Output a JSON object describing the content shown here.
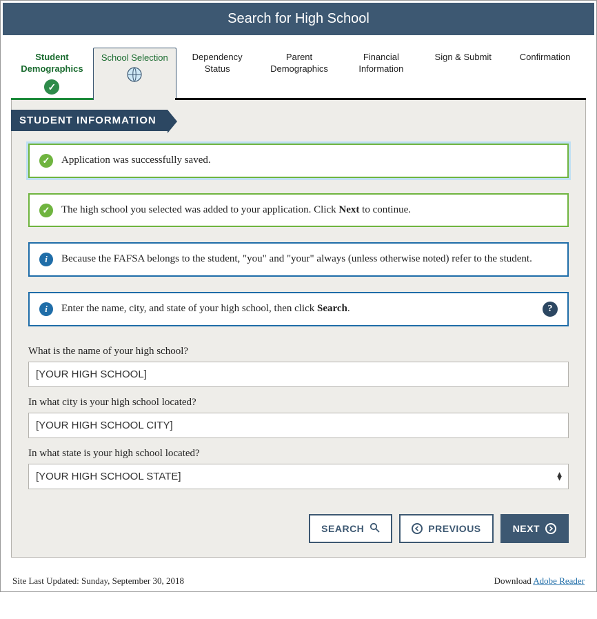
{
  "header": {
    "title": "Search for High School"
  },
  "tabs": [
    {
      "label": "Student Demographics",
      "state": "completed"
    },
    {
      "label": "School Selection",
      "state": "active"
    },
    {
      "label": "Dependency Status",
      "state": "default"
    },
    {
      "label": "Parent Demographics",
      "state": "default"
    },
    {
      "label": "Financial Information",
      "state": "default"
    },
    {
      "label": "Sign & Submit",
      "state": "default"
    },
    {
      "label": "Confirmation",
      "state": "default"
    }
  ],
  "section_ribbon": "STUDENT INFORMATION",
  "alerts": {
    "saved": "Application was successfully saved.",
    "added_prefix": "The high school you selected was added to your application. Click ",
    "added_bold": "Next",
    "added_suffix": " to continue.",
    "ownership": "Because the FAFSA belongs to the student, \"you\" and \"your\" always (unless otherwise noted) refer to the student.",
    "instruction_prefix": "Enter the name, city, and state of your high school, then click ",
    "instruction_bold": "Search",
    "instruction_suffix": "."
  },
  "fields": {
    "name": {
      "label": "What is the name of your high school?",
      "value": "[YOUR HIGH SCHOOL]"
    },
    "city": {
      "label": "In what city is your high school located?",
      "value": "[YOUR HIGH SCHOOL CITY]"
    },
    "state": {
      "label": "In what state is your high school located?",
      "value": "[YOUR HIGH SCHOOL STATE]"
    }
  },
  "buttons": {
    "search": "SEARCH",
    "previous": "PREVIOUS",
    "next": "NEXT"
  },
  "help_label": "?",
  "footer": {
    "updated": "Site Last Updated: Sunday, September 30, 2018",
    "download_prefix": "Download ",
    "download_link": "Adobe Reader"
  }
}
